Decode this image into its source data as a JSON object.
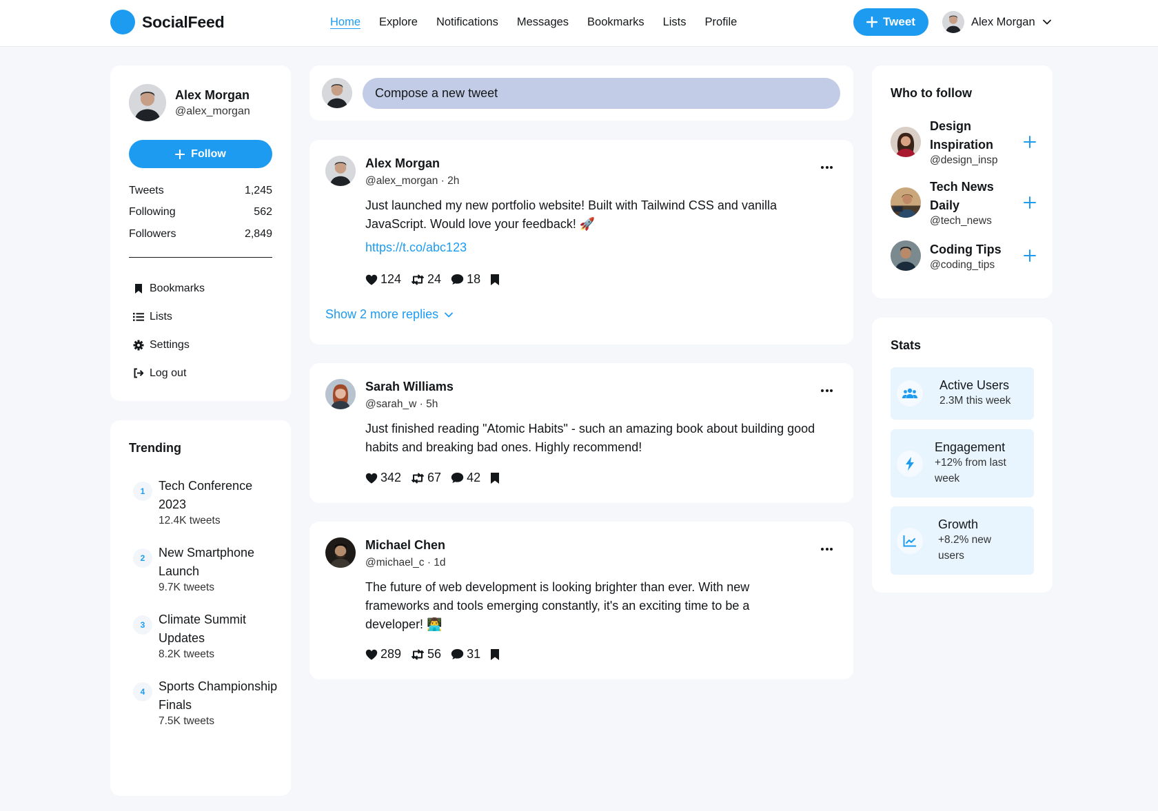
{
  "app": {
    "name": "SocialFeed",
    "brand_color": "#1d9bf0"
  },
  "nav": {
    "links": [
      "Home",
      "Explore",
      "Notifications",
      "Messages",
      "Bookmarks",
      "Lists",
      "Profile"
    ],
    "active": "Home",
    "tweet_button": "Tweet",
    "user_name": "Alex Morgan"
  },
  "profile": {
    "name": "Alex Morgan",
    "handle": "@alex_morgan",
    "follow_label": "Follow",
    "stats": [
      {
        "label": "Tweets",
        "value": "1,245"
      },
      {
        "label": "Following",
        "value": "562"
      },
      {
        "label": "Followers",
        "value": "2,849"
      }
    ],
    "menu": [
      {
        "label": "Bookmarks",
        "icon": "bookmark-icon"
      },
      {
        "label": "Lists",
        "icon": "list-icon"
      },
      {
        "label": "Settings",
        "icon": "gear-icon"
      },
      {
        "label": "Log out",
        "icon": "logout-icon"
      }
    ]
  },
  "trending": {
    "title": "Trending",
    "items": [
      {
        "rank": "1",
        "title": "Tech Conference 2023",
        "count": "12.4K tweets"
      },
      {
        "rank": "2",
        "title": "New Smartphone Launch",
        "count": "9.7K tweets"
      },
      {
        "rank": "3",
        "title": "Climate Summit Updates",
        "count": "8.2K tweets"
      },
      {
        "rank": "4",
        "title": "Sports Championship Finals",
        "count": "7.5K tweets"
      }
    ]
  },
  "compose": {
    "placeholder": "Compose a new tweet"
  },
  "tweets": [
    {
      "name": "Alex Morgan",
      "meta": "@alex_morgan · 2h",
      "text": "Just launched my new portfolio website! Built with Tailwind CSS and vanilla JavaScript. Would love your feedback! 🚀",
      "link": "https://t.co/abc123",
      "likes": "124",
      "retweets": "24",
      "replies": "18",
      "show_more": "Show 2 more replies"
    },
    {
      "name": "Sarah Williams",
      "meta": "@sarah_w · 5h",
      "text": "Just finished reading \"Atomic Habits\" - such an amazing book about building good habits and breaking bad ones. Highly recommend!",
      "likes": "342",
      "retweets": "67",
      "replies": "42"
    },
    {
      "name": "Michael Chen",
      "meta": "@michael_c · 1d",
      "text": "The future of web development is looking brighter than ever. With new frameworks and tools emerging constantly, it's an exciting time to be a developer! 👨‍💻",
      "likes": "289",
      "retweets": "56",
      "replies": "31"
    }
  ],
  "who_to_follow": {
    "title": "Who to follow",
    "items": [
      {
        "name": "Design Inspiration",
        "handle": "@design_insp"
      },
      {
        "name": "Tech News Daily",
        "handle": "@tech_news"
      },
      {
        "name": "Coding Tips",
        "handle": "@coding_tips"
      }
    ]
  },
  "stats": {
    "title": "Stats",
    "items": [
      {
        "title": "Active Users",
        "sub": "2.3M this week",
        "icon": "users-icon"
      },
      {
        "title": "Engagement",
        "sub": "+12% from last week",
        "icon": "bolt-icon"
      },
      {
        "title": "Growth",
        "sub": "+8.2% new users",
        "icon": "chart-line-icon"
      }
    ]
  }
}
